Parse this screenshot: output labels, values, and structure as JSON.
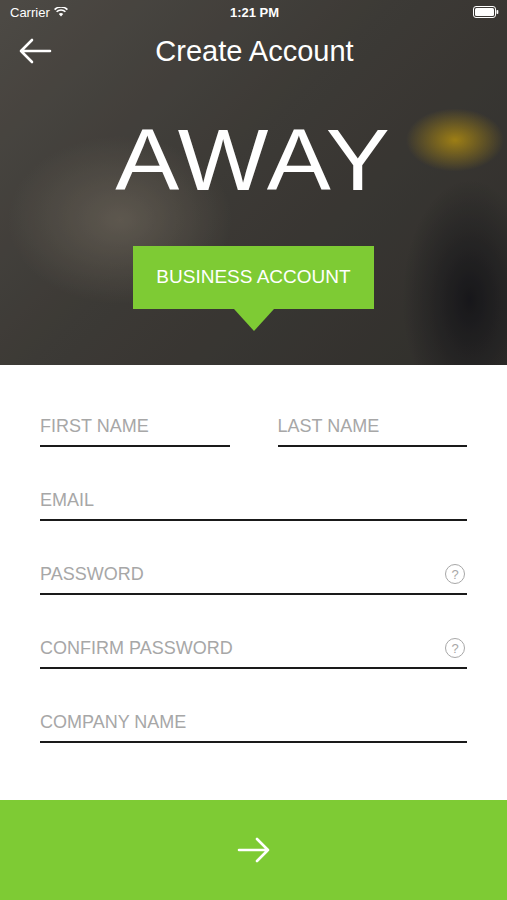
{
  "status_bar": {
    "carrier": "Carrier",
    "time": "1:21 PM"
  },
  "header": {
    "title": "Create Account"
  },
  "logo": "AWAY",
  "badge": "BUSINESS ACCOUNT",
  "name_fields": [
    {
      "placeholder": "FIRST NAME",
      "help": false
    },
    {
      "placeholder": "LAST NAME",
      "help": false
    }
  ],
  "fields": [
    {
      "placeholder": "EMAIL",
      "help": false
    },
    {
      "placeholder": "PASSWORD",
      "help": true
    },
    {
      "placeholder": "CONFIRM PASSWORD",
      "help": true
    },
    {
      "placeholder": "COMPANY NAME",
      "help": false
    }
  ],
  "help_glyph": "?"
}
